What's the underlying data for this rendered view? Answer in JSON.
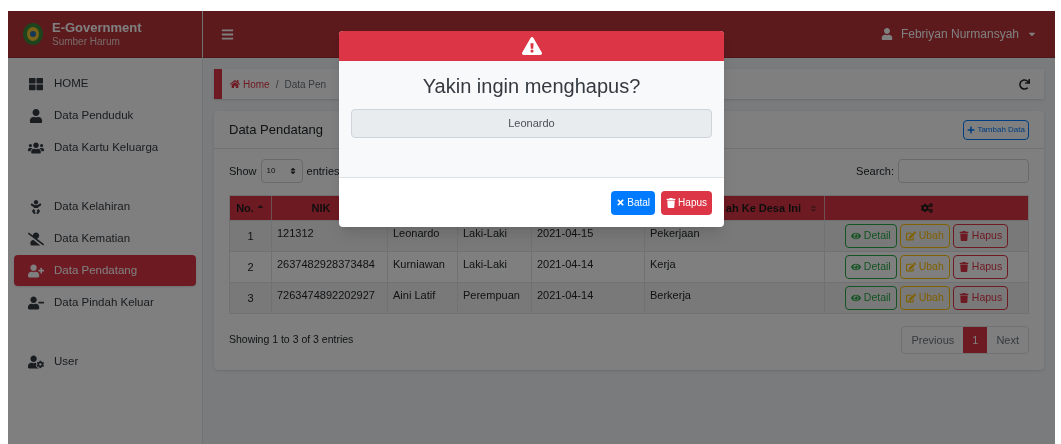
{
  "brand": {
    "title": "E-Government",
    "subtitle": "Sumber Harum"
  },
  "user": {
    "name": "Febriyan Nurmansyah"
  },
  "sidebar": {
    "groups": [
      [
        {
          "label": "HOME",
          "selected": false
        },
        {
          "label": "Data Penduduk",
          "selected": false
        },
        {
          "label": "Data Kartu Keluarga",
          "selected": false
        }
      ],
      [
        {
          "label": "Data Kelahiran",
          "selected": false
        },
        {
          "label": "Data Kematian",
          "selected": false
        },
        {
          "label": "Data Pendatang",
          "selected": true
        },
        {
          "label": "Data Pindah Keluar",
          "selected": false
        }
      ],
      [
        {
          "label": "User",
          "selected": false
        }
      ]
    ]
  },
  "breadcrumb": {
    "home": "Home",
    "separator": "/",
    "current": "Data Pen"
  },
  "card": {
    "title": "Data Pendatang",
    "add_button": "Tambah Data",
    "length": {
      "show": "Show",
      "value": "10",
      "entries": "entries"
    },
    "search": {
      "label": "Search:"
    },
    "table": {
      "columns": [
        {
          "label": "No.",
          "sorted": true
        },
        {
          "label": "NIK",
          "sorted": false
        },
        {
          "label": "ah Ke Desa Ini",
          "sorted": false
        }
      ],
      "rows": [
        {
          "cells": [
            "1",
            "121312",
            "Leonardo",
            "Laki-Laki",
            "2021-04-15",
            "Pekerjaan"
          ],
          "actions": [
            "Detail",
            "Ubah",
            "Hapus"
          ]
        },
        {
          "cells": [
            "2",
            "2637482928373484",
            "Kurniawan",
            "Laki-Laki",
            "2021-04-14",
            "Kerja"
          ],
          "actions": [
            "Detail",
            "Ubah",
            "Hapus"
          ]
        },
        {
          "cells": [
            "3",
            "7263474892202927",
            "Aini Latif",
            "Perempuan",
            "2021-04-14",
            "Berkerja"
          ],
          "actions": [
            "Detail",
            "Ubah",
            "Hapus"
          ]
        }
      ]
    },
    "info": "Showing 1 to 3 of 3 entries",
    "pagination": [
      {
        "label": "Previous",
        "selected": false
      },
      {
        "label": "1",
        "selected": true
      },
      {
        "label": "Next",
        "selected": false
      }
    ]
  },
  "modal": {
    "title": "Yakin ingin menghapus?",
    "name": "Leonardo",
    "cancel": "Batal",
    "confirm": "Hapus"
  }
}
